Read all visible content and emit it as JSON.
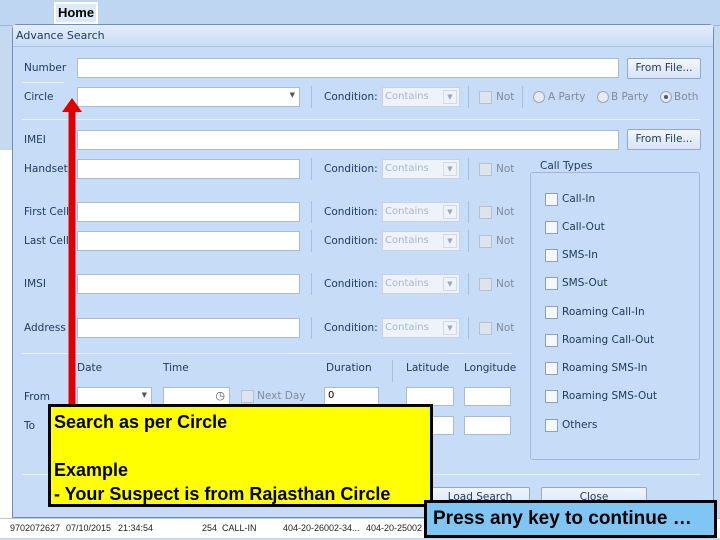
{
  "ribbon": {
    "home_tab": "Home"
  },
  "dialog": {
    "title": "Advance Search",
    "fields": {
      "number": "Number",
      "circle": "Circle",
      "imei": "IMEI",
      "handset": "Handset",
      "first_cell": "First Cell",
      "last_cell": "Last Cell",
      "imsi": "IMSI",
      "address": "Address"
    },
    "from_file": "From File...",
    "condition_label": "Condition:",
    "condition_value": "Contains",
    "not_label": "Not",
    "party": {
      "a": "A Party",
      "b": "B Party",
      "both": "Both",
      "selected": "Both"
    },
    "call_types": {
      "title": "Call Types",
      "items": [
        "Call-In",
        "Call-Out",
        "SMS-In",
        "SMS-Out",
        "Roaming Call-In",
        "Roaming Call-Out",
        "Roaming SMS-In",
        "Roaming SMS-Out",
        "Others"
      ]
    },
    "headers": {
      "date": "Date",
      "time": "Time",
      "duration": "Duration",
      "latitude": "Latitude",
      "longitude": "Longitude"
    },
    "from_label": "From",
    "to_label": "To",
    "next_day": "Next Day",
    "duration_from": "0",
    "load_search": "Load Search",
    "close": "Close"
  },
  "grid_row": [
    "9702072627",
    "07/10/2015",
    "21:34:54",
    "254",
    "CALL-IN",
    "404-20-26002-34...",
    "404-20-25002"
  ],
  "callout": {
    "line1": "Search as per Circle",
    "line2": "Example",
    "line3": "- Your Suspect is from Rajasthan Circle"
  },
  "press_key": "Press any key to continue …",
  "colors": {
    "callout": "#ffff00",
    "arrow": "#e00000",
    "press_bg": "#7fc6f4"
  }
}
